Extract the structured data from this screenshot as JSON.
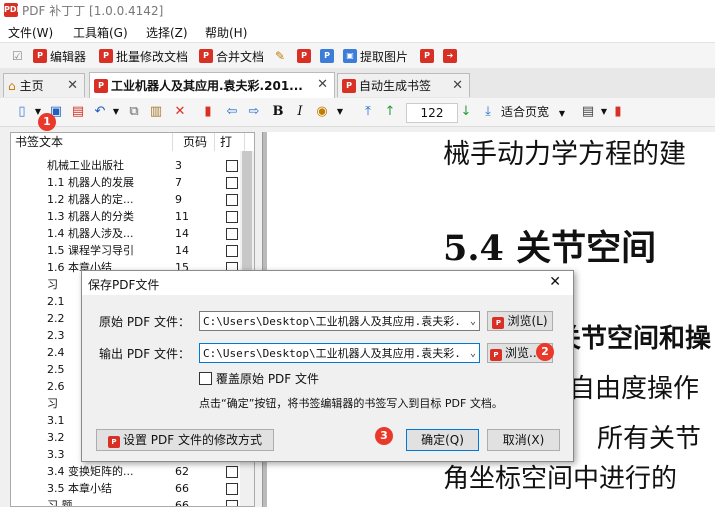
{
  "window": {
    "title": "PDF 补丁丁 [1.0.0.4142]"
  },
  "menu": [
    "文件(W)",
    "工具箱(G)",
    "选择(Z)",
    "帮助(H)"
  ],
  "toolbar1": {
    "editor": "编辑器",
    "batch_modify": "批量修改文档",
    "merge": "合并文档",
    "extract_images": "提取图片"
  },
  "tabs": [
    {
      "label": "主页",
      "active": false
    },
    {
      "label": "工业机器人及其应用.袁夫彩.201...",
      "active": true
    },
    {
      "label": "自动生成书签",
      "active": false
    }
  ],
  "toolbar2": {
    "page_number": "122",
    "fit_mode": "适合页宽"
  },
  "bookmarks": {
    "headers": [
      "书签文本",
      "页码",
      "打"
    ],
    "rows": [
      {
        "text": "机械工业出版社",
        "page": "3"
      },
      {
        "text": "1.1    机器人的发展",
        "page": "7"
      },
      {
        "text": "1.2    机器人的定...",
        "page": "9"
      },
      {
        "text": "1.3    机器人的分类",
        "page": "11"
      },
      {
        "text": "1.4    机器人涉及...",
        "page": "14"
      },
      {
        "text": "1.5    课程学习导引",
        "page": "14"
      },
      {
        "text": "1.6    本章小结",
        "page": "15"
      },
      {
        "text": "习",
        "page": ""
      },
      {
        "text": "2.1",
        "page": ""
      },
      {
        "text": "2.2",
        "page": ""
      },
      {
        "text": "2.3",
        "page": ""
      },
      {
        "text": "2.4",
        "page": ""
      },
      {
        "text": "2.5",
        "page": ""
      },
      {
        "text": "2.6",
        "page": ""
      },
      {
        "text": "习",
        "page": ""
      },
      {
        "text": "3.1",
        "page": ""
      },
      {
        "text": "3.2",
        "page": ""
      },
      {
        "text": "3.3",
        "page": ""
      },
      {
        "text": "3.4    变换矩阵的...",
        "page": "62"
      },
      {
        "text": "3.5    本章小结",
        "page": "66"
      },
      {
        "text": "习      题",
        "page": "66"
      }
    ]
  },
  "document": {
    "lines": [
      "械手动力学方程的建",
      "5.4    关节空间",
      "关节空间和操",
      "自由度操作",
      "所有关节",
      "角坐标空间中进行的"
    ]
  },
  "dialog": {
    "title": "保存PDF文件",
    "source_label": "原始 PDF 文件：",
    "source_value": "C:\\Users\\Desktop\\工业机器人及其应用.袁夫彩.",
    "output_label": "输出 PDF 文件：",
    "output_value": "C:\\Users\\Desktop\\工业机器人及其应用.袁夫彩.",
    "browse1": "浏览(L)",
    "browse2": "浏览...",
    "overwrite_label": "覆盖原始 PDF 文件",
    "hint": "点击“确定”按钮，将书签编辑器的书签写入到目标 PDF 文档。",
    "settings_button": "设置 PDF 文件的修改方式",
    "ok": "确定(Q)",
    "cancel": "取消(X)"
  },
  "badges": [
    "1",
    "2",
    "3"
  ]
}
